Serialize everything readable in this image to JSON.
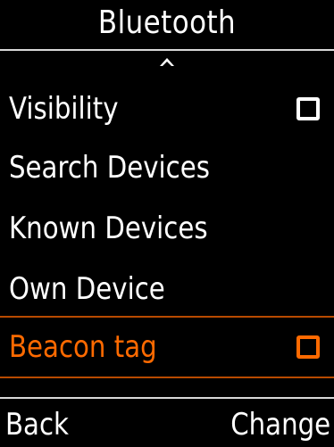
{
  "header": {
    "title": "Bluetooth"
  },
  "menu": {
    "items": [
      {
        "label": "Visibility",
        "checked": false,
        "has_checkbox": true,
        "selected": false
      },
      {
        "label": "Search Devices",
        "has_checkbox": false,
        "selected": false
      },
      {
        "label": "Known Devices",
        "has_checkbox": false,
        "selected": false
      },
      {
        "label": "Own Device",
        "has_checkbox": false,
        "selected": false
      },
      {
        "label": "Beacon tag",
        "checked": false,
        "has_checkbox": true,
        "selected": true
      }
    ],
    "scroll_indicator_icon": "chevron-up-icon"
  },
  "softkeys": {
    "left": "Back",
    "right": "Change"
  },
  "colors": {
    "background": "#000000",
    "text": "#ffffff",
    "accent": "#ff6a00",
    "divider": "#d8d8d8"
  }
}
